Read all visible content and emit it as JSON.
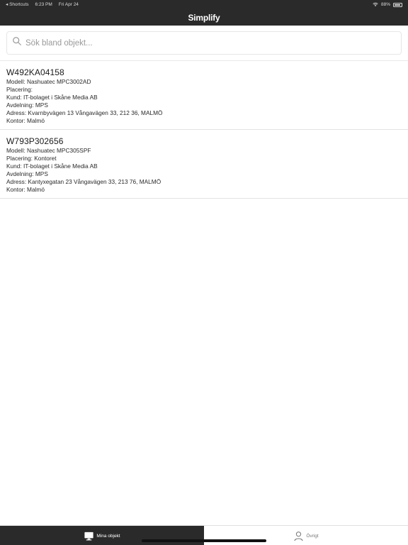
{
  "status_bar": {
    "back_app": "◂ Shortcuts",
    "time": "6:23 PM",
    "date": "Fri Apr 24",
    "battery": "88%"
  },
  "nav": {
    "title": "Simplify"
  },
  "search": {
    "placeholder": "Sök bland objekt..."
  },
  "items": [
    {
      "id": "W492KA04158",
      "lines": [
        "Modell: Nashuatec MPC3002AD",
        "Placering:",
        "Kund: IT-bolaget i Skåne Media AB",
        "Avdelning: MPS",
        "Adress: Kvarnbyvägen 13 Vångavägen 33, 212 36, MALMÖ",
        "Kontor: Malmö"
      ]
    },
    {
      "id": "W793P302656",
      "lines": [
        "Modell: Nashuatec MPC305SPF",
        "Placering: Kontoret",
        "Kund: IT-bolaget i Skåne Media AB",
        "Avdelning: MPS",
        "Adress: Kantyxegatan 23 Vångavägen 33, 213 76, MALMÖ",
        "Kontor: Malmö"
      ]
    }
  ],
  "tabs": [
    {
      "label": "Mina objekt",
      "icon": "computer-icon",
      "active": true
    },
    {
      "label": "Övrigt",
      "icon": "person-icon",
      "active": false
    }
  ],
  "colors": {
    "bar_dark": "#2a2a2a",
    "background": "#ffffff",
    "divider": "#e3e3e3"
  }
}
